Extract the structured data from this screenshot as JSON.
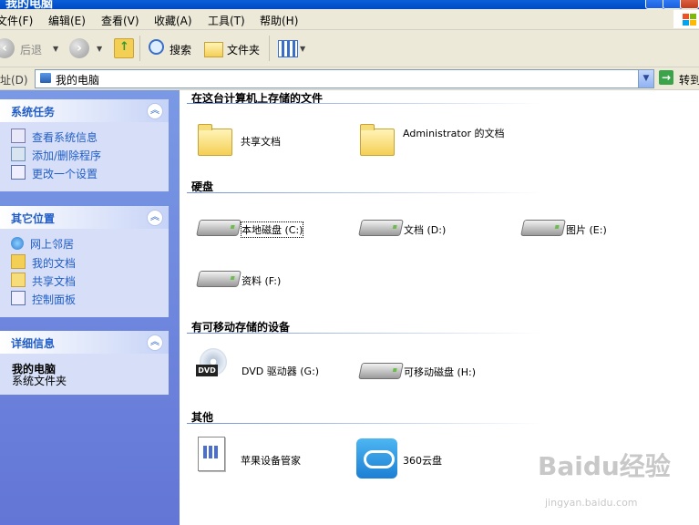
{
  "window": {
    "title": "我的电脑"
  },
  "menu": [
    "文件(F)",
    "编辑(E)",
    "查看(V)",
    "收藏(A)",
    "工具(T)",
    "帮助(H)"
  ],
  "toolbar": {
    "back": "后退",
    "search": "搜索",
    "folders": "文件夹"
  },
  "address": {
    "label": "地址(D)",
    "value": "我的电脑",
    "go": "转到"
  },
  "taskpane": {
    "system_tasks": {
      "title": "系统任务",
      "items": [
        "查看系统信息",
        "添加/删除程序",
        "更改一个设置"
      ]
    },
    "other_places": {
      "title": "其它位置",
      "items": [
        "网上邻居",
        "我的文档",
        "共享文档",
        "控制面板"
      ]
    },
    "details": {
      "title": "详细信息",
      "name": "我的电脑",
      "type": "系统文件夹"
    }
  },
  "groups": {
    "stored": {
      "title": "在这台计算机上存储的文件",
      "items": [
        "共享文档",
        "Administrator 的文档"
      ]
    },
    "hdd": {
      "title": "硬盘",
      "items": [
        "本地磁盘 (C:)",
        "文档 (D:)",
        "图片 (E:)",
        "资料 (F:)"
      ]
    },
    "removable": {
      "title": "有可移动存储的设备",
      "items": [
        "DVD 驱动器 (G:)",
        "可移动磁盘 (H:)"
      ]
    },
    "other": {
      "title": "其他",
      "items": [
        "苹果设备管家",
        "360云盘"
      ]
    }
  },
  "watermark": {
    "main": "Baidu经验",
    "sub": "jingyan.baidu.com"
  }
}
